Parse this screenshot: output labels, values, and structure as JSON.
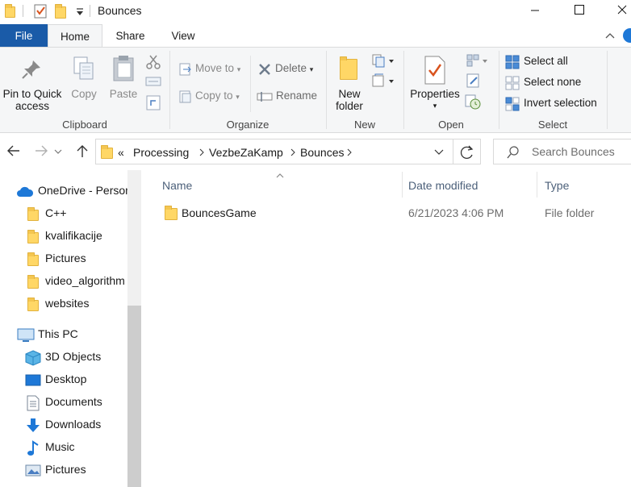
{
  "window": {
    "title": "Bounces"
  },
  "ribbon_tabs": [
    {
      "label": "File"
    },
    {
      "label": "Home"
    },
    {
      "label": "Share"
    },
    {
      "label": "View"
    }
  ],
  "ribbon": {
    "clipboard": {
      "label": "Clipboard",
      "pin_line1": "Pin to Quick",
      "pin_line2": "access",
      "copy": "Copy",
      "paste": "Paste"
    },
    "organize": {
      "label": "Organize",
      "move_to": "Move to",
      "copy_to": "Copy to",
      "delete": "Delete",
      "rename": "Rename"
    },
    "new": {
      "label": "New",
      "new_folder_line1": "New",
      "new_folder_line2": "folder"
    },
    "open": {
      "label": "Open",
      "properties": "Properties"
    },
    "select": {
      "label": "Select",
      "select_all": "Select all",
      "select_none": "Select none",
      "invert_selection": "Invert selection"
    }
  },
  "address": {
    "overflow": "«",
    "crumbs": [
      "Processing",
      "VezbeZaKamp",
      "Bounces"
    ],
    "search_placeholder": "Search Bounces"
  },
  "nav_pane": {
    "onedrive": "OneDrive - Person",
    "onedrive_folders": [
      "C++",
      "kvalifikacije",
      "Pictures",
      "video_algorithm",
      "websites"
    ],
    "this_pc": "This PC",
    "pc_items": [
      "3D Objects",
      "Desktop",
      "Documents",
      "Downloads",
      "Music",
      "Pictures"
    ]
  },
  "file_list": {
    "columns": [
      "Name",
      "Date modified",
      "Type"
    ],
    "rows": [
      {
        "name": "BouncesGame",
        "date": "6/21/2023 4:06 PM",
        "type": "File folder"
      }
    ]
  },
  "colors": {
    "file_tab": "#1a5ba8",
    "folder_yellow": "#ffd766",
    "accent_blue": "#1e78d7"
  }
}
